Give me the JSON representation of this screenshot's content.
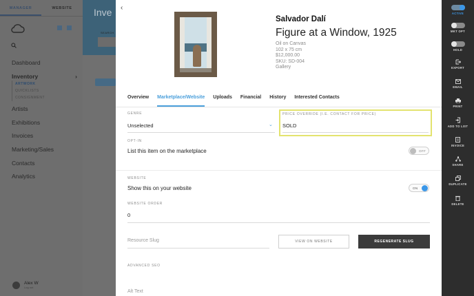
{
  "nav": {
    "switch": [
      "MANAGER",
      "WEBSITE"
    ],
    "items": [
      {
        "label": "Dashboard"
      },
      {
        "label": "Inventory"
      },
      {
        "label": "Artists"
      },
      {
        "label": "Exhibitions"
      },
      {
        "label": "Invoices"
      },
      {
        "label": "Marketing/Sales"
      },
      {
        "label": "Contacts"
      },
      {
        "label": "Analytics"
      }
    ],
    "inventory_chevron": "›",
    "sub": [
      "ARTWORK",
      "QUICKLISTS",
      "CONSIGNMENT"
    ],
    "user": {
      "name": "Alex W",
      "sub": "Log out"
    }
  },
  "list_bg": {
    "title": "Inve",
    "search_label": "SEARCH"
  },
  "artwork": {
    "artist": "Salvador Dalí",
    "title": "Figure at a Window, 1925",
    "medium": "Oil on Canvas",
    "dimensions": "102 x 75 cm",
    "price": "$12,000.00",
    "sku": "SKU: SD-004",
    "location": "Gallery"
  },
  "tabs": [
    "Overview",
    "Marketplace/Website",
    "Uploads",
    "Financial",
    "History",
    "Interested Contacts"
  ],
  "active_tab": "Marketplace/Website",
  "form": {
    "genre_label": "GENRE",
    "genre_value": "Unselected",
    "price_override_label": "PRICE OVERRIDE (I.E. CONTACT FOR PRICE)",
    "price_override_value": "SOLD",
    "optin_label": "OPT-IN",
    "optin_text": "List this item on the marketplace",
    "optin_toggle": "OFF",
    "website_label": "WEBSITE",
    "website_text": "Show this on your website",
    "website_toggle": "ON",
    "website_order_label": "WEBSITE ORDER",
    "website_order_value": "0",
    "resource_slug_placeholder": "Resource Slug",
    "view_on_website": "VIEW ON WEBSITE",
    "regenerate_slug": "REGENERATE SLUG",
    "advanced_seo_label": "ADVANCED SEO",
    "alt_text_placeholder": "Alt Text"
  },
  "toolbar": {
    "active": "ACTIVE",
    "mkt_opt": "MKT OPT",
    "hold": "HOLD",
    "export": "EXPORT",
    "email": "EMAIL",
    "print": "PRINT",
    "add_to_list": "ADD TO LIST",
    "invoice": "INVOICE",
    "share": "SHARE",
    "duplicate": "DUPLICATE",
    "delete": "DELETE"
  },
  "colors": {
    "accent": "#4a9fdb",
    "highlight": "#e3e36e",
    "toolbar_bg": "#2d2d2d",
    "dark_button": "#3b3b3b"
  }
}
